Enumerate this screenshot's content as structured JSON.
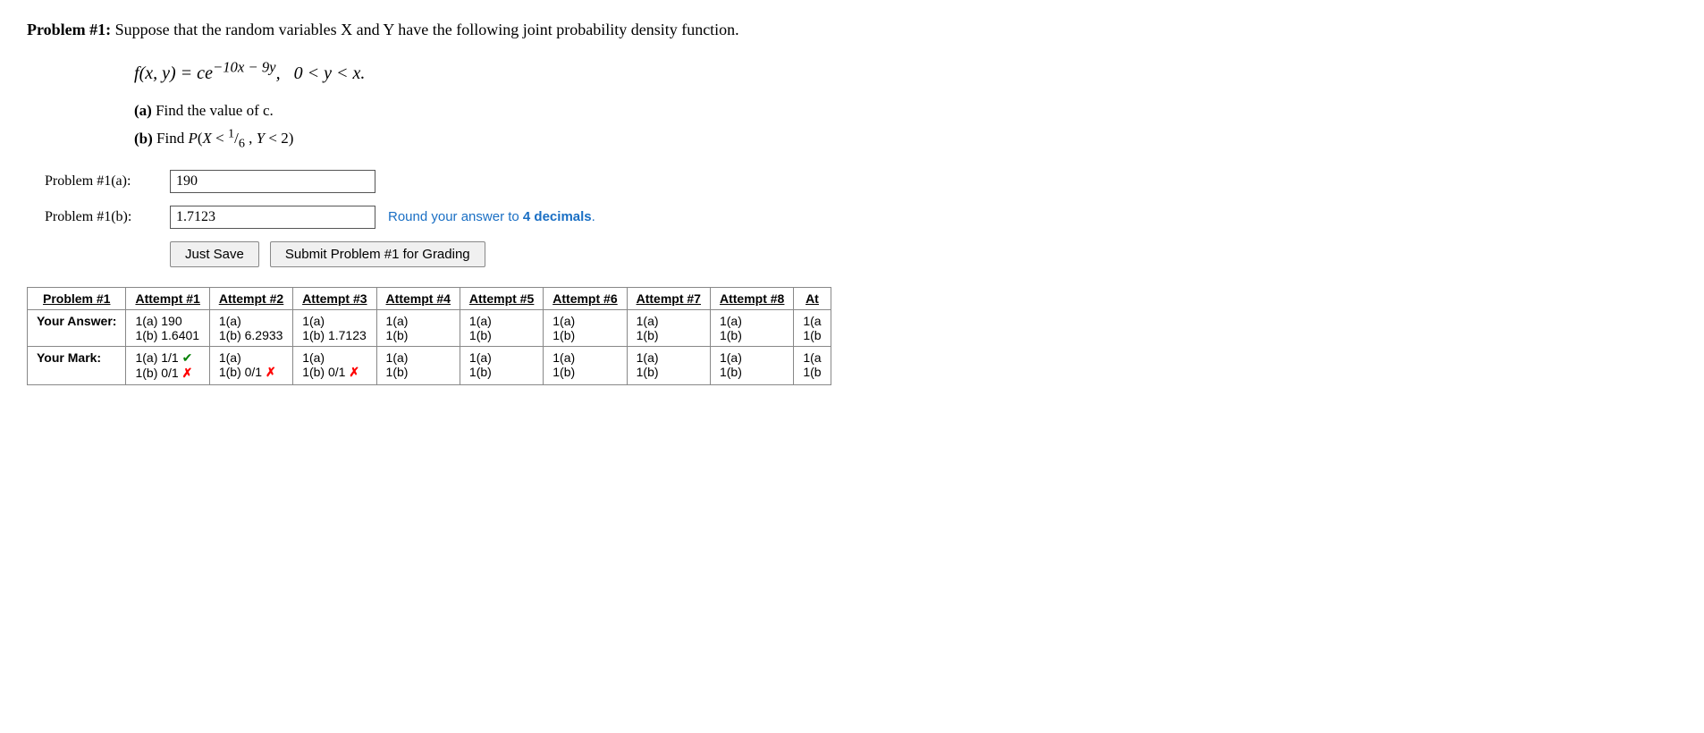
{
  "problem": {
    "title": "Problem #1:",
    "description": "Suppose that the random variables X and Y have the following joint probability density function.",
    "formula_display": "f(x, y) = ce^{-10x - 9y},  0 < y < x.",
    "part_a_label": "(a)",
    "part_a_text": "Find the value of c.",
    "part_b_label": "(b)",
    "part_b_text": "Find P(X < 1/6, Y < 2)",
    "input_a_label": "Problem #1(a):",
    "input_a_value": "190",
    "input_b_label": "Problem #1(b):",
    "input_b_value": "1.7123",
    "hint_prefix": "Round your answer to ",
    "hint_emphasis": "4 decimals",
    "hint_suffix": ".",
    "btn_save": "Just Save",
    "btn_submit": "Submit Problem #1 for Grading"
  },
  "table": {
    "col_headers": [
      "Problem #1",
      "Attempt #1",
      "Attempt #2",
      "Attempt #3",
      "Attempt #4",
      "Attempt #5",
      "Attempt #6",
      "Attempt #7",
      "Attempt #8",
      "At"
    ],
    "row_your_answer": "Your Answer:",
    "row_your_mark": "Your Mark:",
    "attempts": [
      {
        "answer_a": "1(a) 190",
        "answer_b": "1(b) 1.6401",
        "mark_a": "1(a) 1/1",
        "mark_a_symbol": "correct",
        "mark_b": "1(b) 0/1",
        "mark_b_symbol": "wrong"
      },
      {
        "answer_a": "1(a)",
        "answer_b": "1(b) 6.2933",
        "mark_a": "1(a)",
        "mark_a_symbol": "",
        "mark_b": "1(b) 0/1",
        "mark_b_symbol": "wrong"
      },
      {
        "answer_a": "1(a)",
        "answer_b": "1(b) 1.7123",
        "mark_a": "1(a)",
        "mark_a_symbol": "",
        "mark_b": "1(b) 0/1",
        "mark_b_symbol": "wrong"
      },
      {
        "answer_a": "1(a)",
        "answer_b": "1(b)",
        "mark_a": "1(a)",
        "mark_a_symbol": "",
        "mark_b": "1(b)",
        "mark_b_symbol": ""
      },
      {
        "answer_a": "1(a)",
        "answer_b": "1(b)",
        "mark_a": "1(a)",
        "mark_a_symbol": "",
        "mark_b": "1(b)",
        "mark_b_symbol": ""
      },
      {
        "answer_a": "1(a)",
        "answer_b": "1(b)",
        "mark_a": "1(a)",
        "mark_a_symbol": "",
        "mark_b": "1(b)",
        "mark_b_symbol": ""
      },
      {
        "answer_a": "1(a)",
        "answer_b": "1(b)",
        "mark_a": "1(a)",
        "mark_a_symbol": "",
        "mark_b": "1(b)",
        "mark_b_symbol": ""
      },
      {
        "answer_a": "1(a)",
        "answer_b": "1(b)",
        "mark_a": "1(a)",
        "mark_a_symbol": "",
        "mark_b": "1(b)",
        "mark_b_symbol": ""
      },
      {
        "answer_a": "1(a",
        "answer_b": "1(b",
        "mark_a": "1(a",
        "mark_a_symbol": "",
        "mark_b": "1(b",
        "mark_b_symbol": ""
      }
    ]
  }
}
